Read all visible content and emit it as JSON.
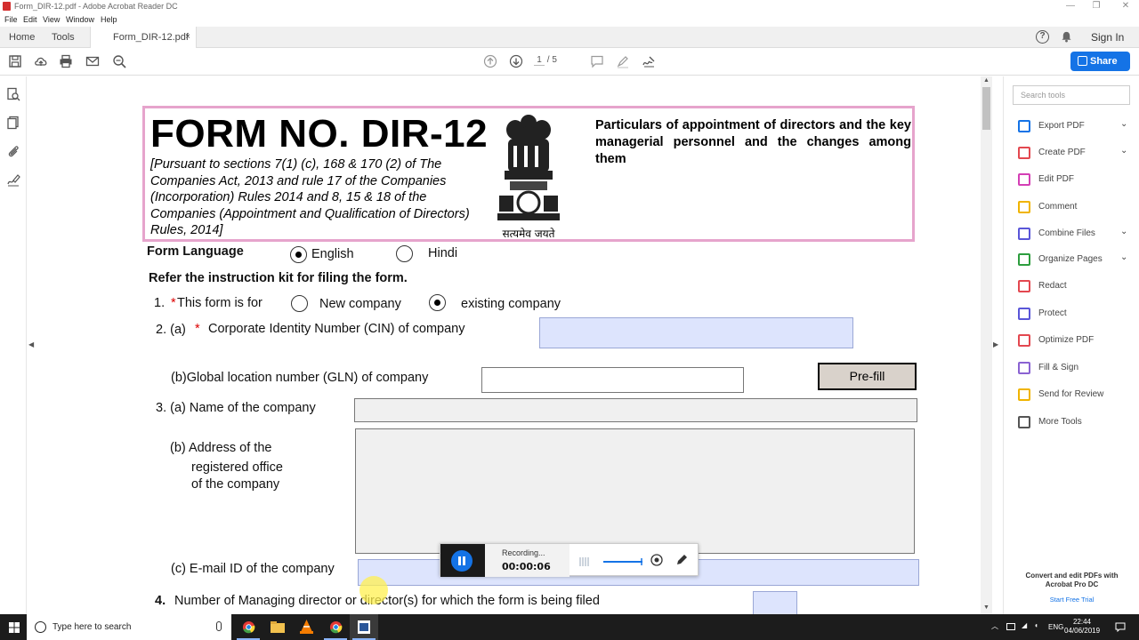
{
  "window": {
    "title": "Form_DIR-12.pdf - Adobe Acrobat Reader DC",
    "minimize": "—",
    "restore": "❐",
    "close": "✕"
  },
  "menu": [
    "File",
    "Edit",
    "View",
    "Window",
    "Help"
  ],
  "tabs": {
    "home": "Home",
    "tools": "Tools",
    "document": "Form_DIR-12.pdf",
    "close": "×"
  },
  "account": {
    "sign_in": "Sign In",
    "help": "?"
  },
  "toolbar": {
    "page_current": "1",
    "page_total": "/ 5",
    "share": "Share",
    "icons": [
      "save-icon",
      "upload-icon",
      "print-icon",
      "email-icon",
      "zoom-icon",
      "page-up-icon",
      "page-down-icon",
      "comment-icon",
      "highlight-icon",
      "sign-icon"
    ]
  },
  "form": {
    "form_no": "FORM NO. DIR-12",
    "pursuant": "[Pursuant to sections 7(1) (c), 168 & 170 (2) of The Companies Act, 2013 and rule 17 of the Companies (Incorporation) Rules 2014 and 8, 15 & 18 of the Companies (Appointment and Qualification of Directors) Rules, 2014]",
    "particulars": "Particulars of appointment of directors and the key managerial personnel and the changes among them",
    "emblem_motto": "सत्यमेव जयते",
    "language_label": "Form Language",
    "language_options": [
      "English",
      "Hindi"
    ],
    "language_selected": "English",
    "instruction": "Refer the instruction kit for filing the form.",
    "q1_num": "1.",
    "q1_req": "*",
    "q1_label": "This form is for",
    "q1_options": [
      "New company",
      "existing company"
    ],
    "q1_selected": "existing company",
    "q2a_num": "2. (a)",
    "q2a_req": "*",
    "q2a_label": "Corporate Identity  Number (CIN) of company",
    "q2b_label": "(b)Global location number (GLN) of company",
    "prefill": "Pre-fill",
    "q3a_label": "3. (a) Name of the company",
    "q3b_lines": [
      "(b) Address of the",
      "registered office",
      "of the company"
    ],
    "q3c_label": "(c) E-mail ID of the company",
    "q4_num": "4.",
    "q4_label": "Number of Managing director or director(s) for which the form is being filed"
  },
  "tools_panel": {
    "search_placeholder": "Search tools",
    "items": [
      {
        "label": "Export PDF",
        "icon": "export-pdf-icon",
        "color": "#1473e6",
        "chevron": true
      },
      {
        "label": "Create PDF",
        "icon": "create-pdf-icon",
        "color": "#e34850",
        "chevron": true
      },
      {
        "label": "Edit PDF",
        "icon": "edit-pdf-icon",
        "color": "#d43fb5",
        "chevron": false
      },
      {
        "label": "Comment",
        "icon": "comment-icon",
        "color": "#f0b400",
        "chevron": false
      },
      {
        "label": "Combine Files",
        "icon": "combine-files-icon",
        "color": "#5a56d8",
        "chevron": true
      },
      {
        "label": "Organize Pages",
        "icon": "organize-pages-icon",
        "color": "#2d9d3e",
        "chevron": true
      },
      {
        "label": "Redact",
        "icon": "redact-icon",
        "color": "#e34850",
        "chevron": false
      },
      {
        "label": "Protect",
        "icon": "protect-icon",
        "color": "#5a56d8",
        "chevron": false
      },
      {
        "label": "Optimize PDF",
        "icon": "optimize-pdf-icon",
        "color": "#e34850",
        "chevron": false
      },
      {
        "label": "Fill & Sign",
        "icon": "fill-sign-icon",
        "color": "#8a63d2",
        "chevron": false
      },
      {
        "label": "Send for Review",
        "icon": "send-review-icon",
        "color": "#f0b400",
        "chevron": false
      },
      {
        "label": "More Tools",
        "icon": "more-tools-icon",
        "color": "#555555",
        "chevron": false
      }
    ],
    "promo": "Convert and edit PDFs with Acrobat Pro DC",
    "promo_link": "Start Free Trial"
  },
  "recorder": {
    "status": "Recording...",
    "time": "00:00:06"
  },
  "taskbar": {
    "search_placeholder": "Type here to search",
    "language": "ENG",
    "time": "22:44",
    "date": "04/06/2019"
  },
  "colors": {
    "accent": "#1473e6",
    "header_border": "#e6a4cc",
    "field_blue": "#dde4fd"
  }
}
